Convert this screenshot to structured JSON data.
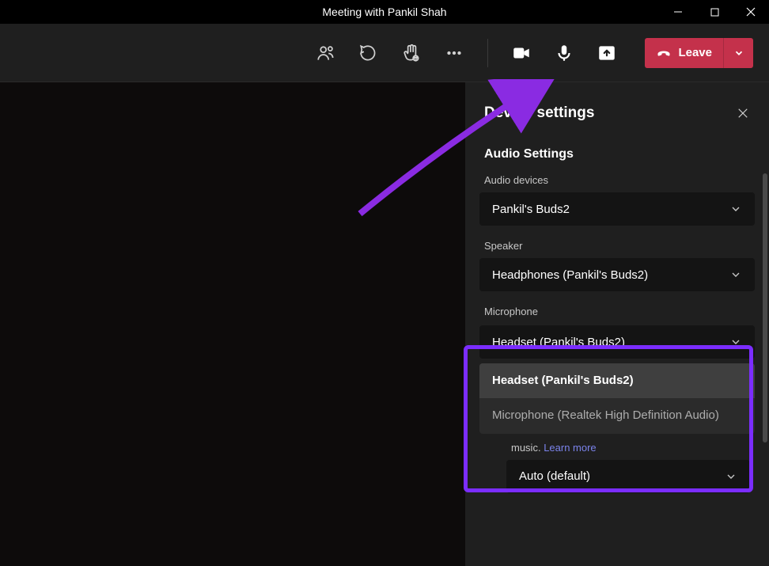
{
  "window": {
    "title": "Meeting with Pankil Shah"
  },
  "toolbar": {
    "leave_label": "Leave"
  },
  "panel": {
    "title": "Device settings",
    "audio_settings_title": "Audio Settings",
    "audio_devices_label": "Audio devices",
    "audio_devices_value": "Pankil's Buds2",
    "speaker_label": "Speaker",
    "speaker_value": "Headphones (Pankil's Buds2)",
    "microphone_label": "Microphone",
    "microphone_value": "Headset (Pankil's Buds2)",
    "mic_options": [
      "Headset (Pankil's Buds2)",
      "Microphone (Realtek High Definition Audio)"
    ],
    "music_text": "music.",
    "learn_more": "Learn more",
    "noise_value": "Auto (default)"
  }
}
